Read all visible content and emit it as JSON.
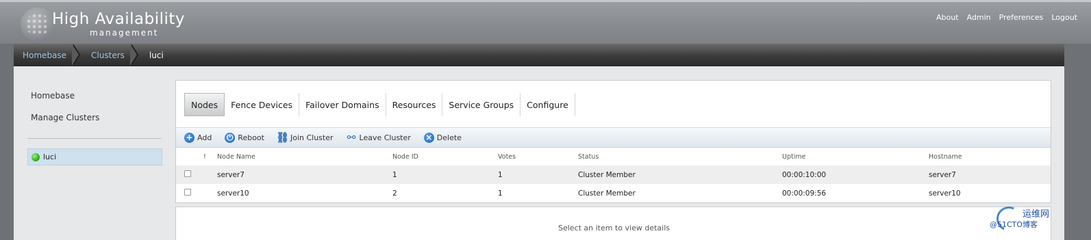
{
  "brand": {
    "title": "High Availability",
    "subtitle": "management"
  },
  "top_links": [
    "About",
    "Admin",
    "Preferences",
    "Logout"
  ],
  "breadcrumb": [
    "Homebase",
    "Clusters",
    "luci"
  ],
  "sidebar": {
    "links": [
      "Homebase",
      "Manage Clusters"
    ],
    "clusters": [
      {
        "name": "luci",
        "status_color": "#31b21c"
      }
    ]
  },
  "tabs": [
    "Nodes",
    "Fence Devices",
    "Failover Domains",
    "Resources",
    "Service Groups",
    "Configure"
  ],
  "active_tab": "Nodes",
  "toolbar": [
    {
      "label": "Add",
      "icon": "add-icon"
    },
    {
      "label": "Reboot",
      "icon": "power-icon"
    },
    {
      "label": "Join Cluster",
      "icon": "link-icon"
    },
    {
      "label": "Leave Cluster",
      "icon": "unlink-icon"
    },
    {
      "label": "Delete",
      "icon": "delete-icon"
    }
  ],
  "table": {
    "columns": [
      "!",
      "Node Name",
      "Node ID",
      "Votes",
      "Status",
      "Uptime",
      "Hostname"
    ],
    "rows": [
      {
        "name": "server7",
        "id": "1",
        "votes": "1",
        "status": "Cluster  Member",
        "uptime": "00:00:10:00",
        "hostname": "server7"
      },
      {
        "name": "server10",
        "id": "2",
        "votes": "1",
        "status": "Cluster  Member",
        "uptime": "00:00:09:56",
        "hostname": "server10"
      }
    ]
  },
  "details": {
    "placeholder": "Select  an  item  to  view  details"
  },
  "watermark": {
    "line1": "运维网",
    "line2": "@51CTO博客"
  },
  "colors": {
    "accent": "#1a5fb4",
    "breadcrumb_link": "#9fc4e0",
    "selected_bg": "#cfe0ee"
  }
}
